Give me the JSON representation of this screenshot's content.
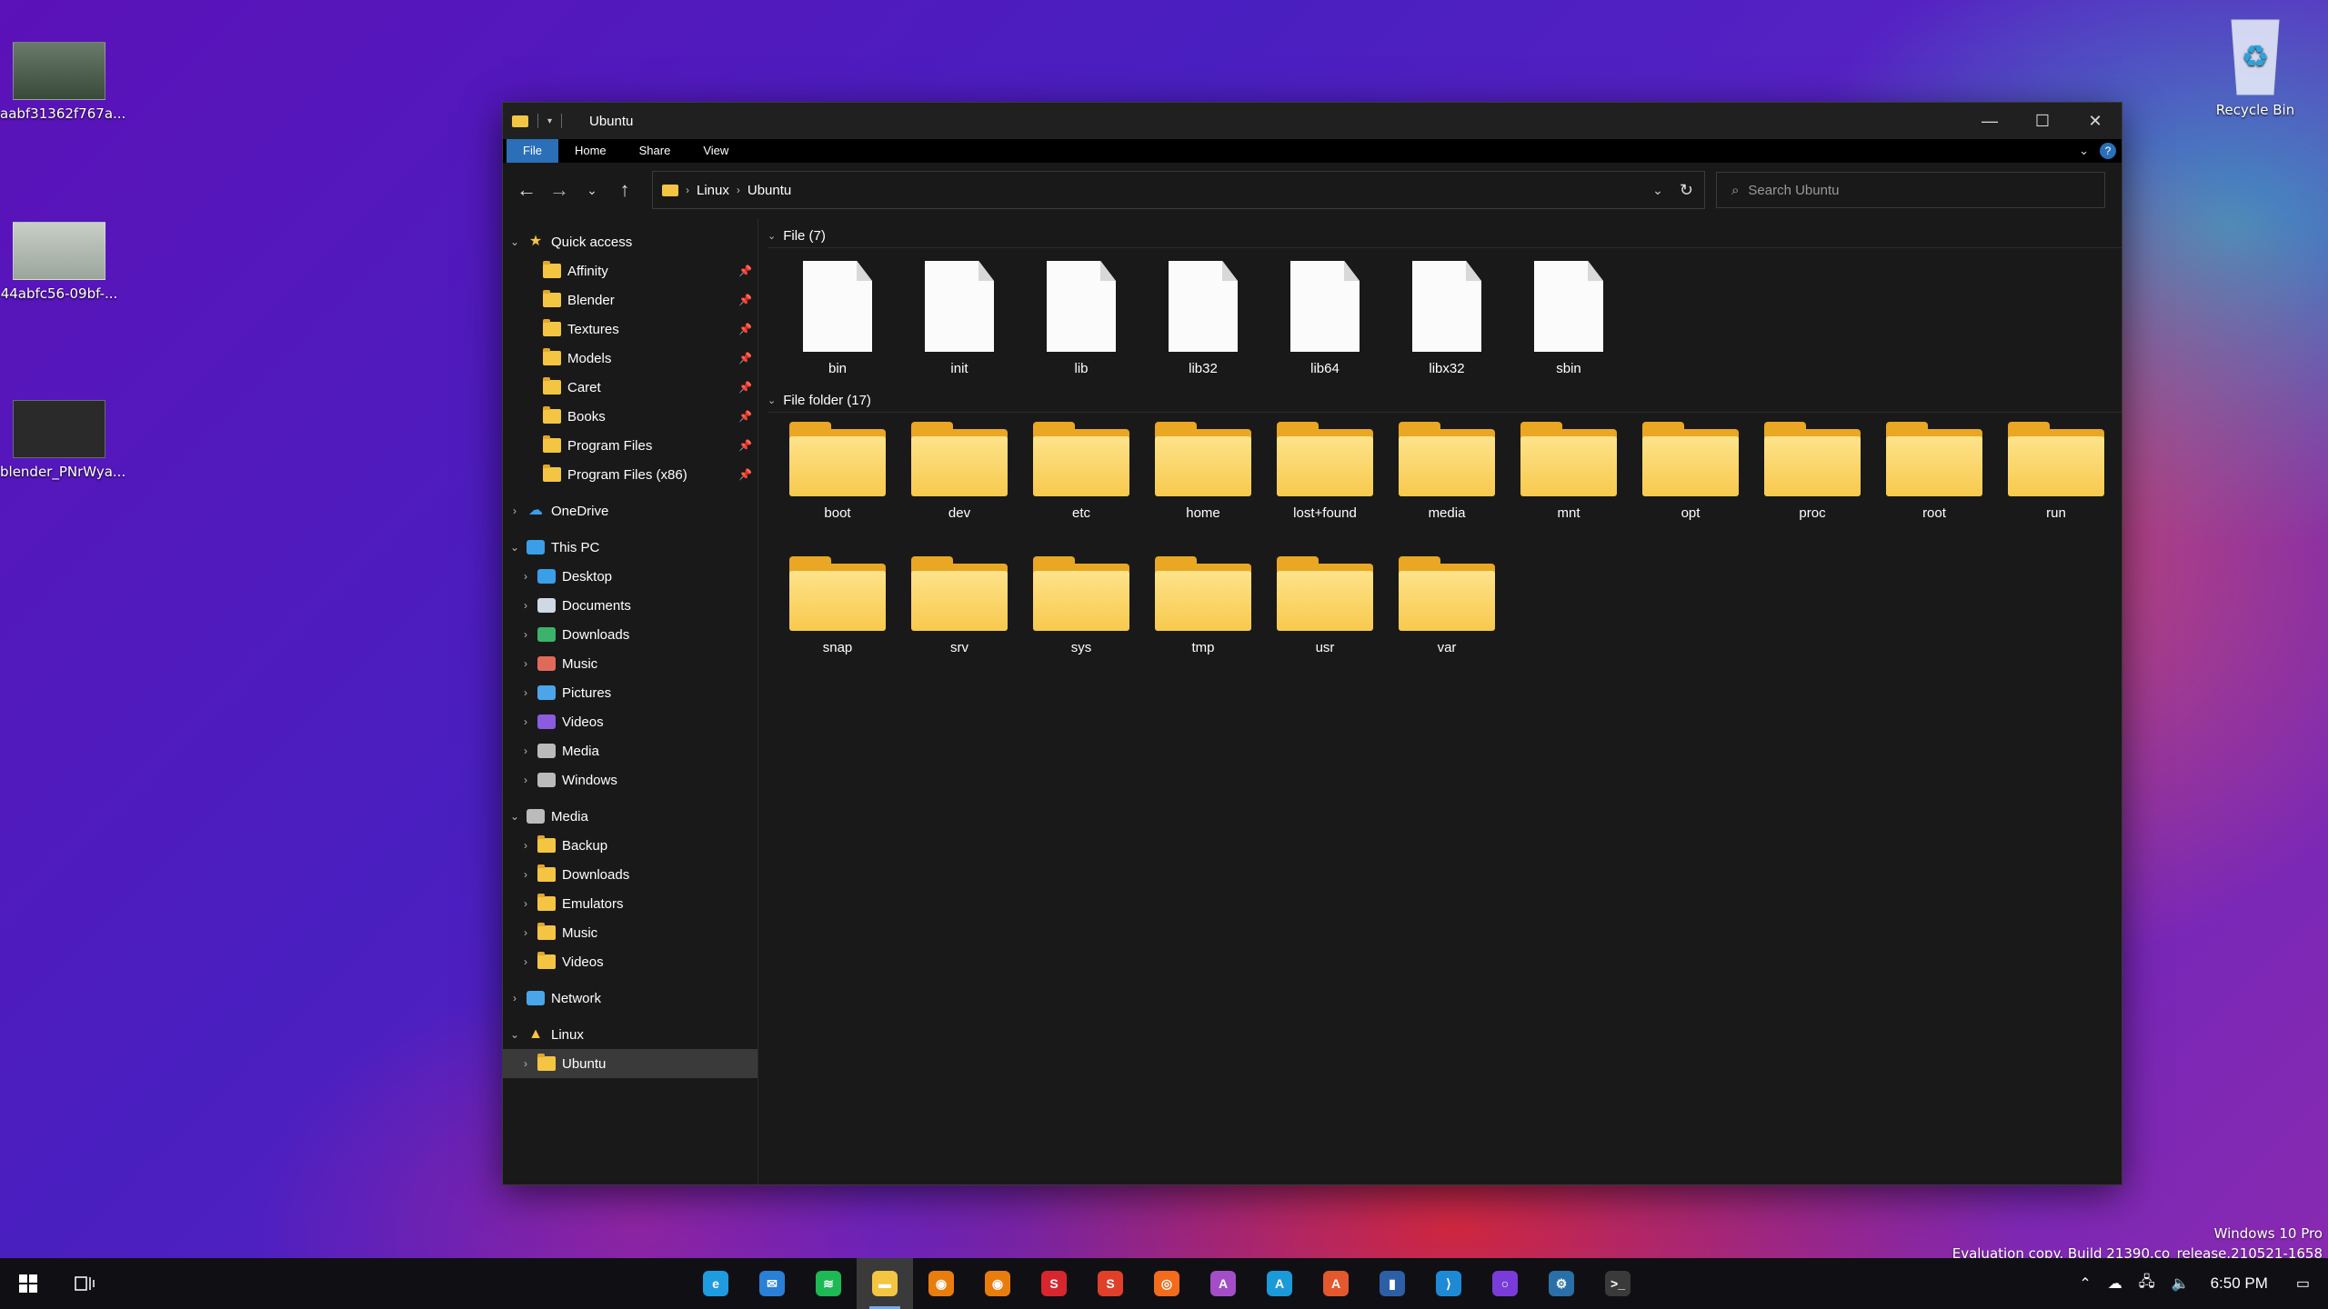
{
  "desktop": {
    "icons": [
      {
        "label": "aabf31362f767a..."
      },
      {
        "label": "44abfc56-09bf-..."
      },
      {
        "label": "blender_PNrWya..."
      }
    ],
    "recycle_bin": "Recycle Bin",
    "watermark": {
      "line1": "Windows 10 Pro",
      "line2": "Evaluation copy. Build 21390.co_release.210521-1658"
    }
  },
  "window": {
    "title": "Ubuntu",
    "ribbon_tabs": [
      "File",
      "Home",
      "Share",
      "View"
    ],
    "help_label": "?",
    "address": {
      "crumbs": [
        "Linux",
        "Ubuntu"
      ]
    },
    "search_placeholder": "Search Ubuntu",
    "sidebar": {
      "quick_access": {
        "label": "Quick access",
        "items": [
          "Affinity",
          "Blender",
          "Textures",
          "Models",
          "Caret",
          "Books",
          "Program Files",
          "Program Files (x86)"
        ]
      },
      "onedrive": "OneDrive",
      "this_pc": {
        "label": "This PC",
        "items": [
          {
            "label": "Desktop",
            "icon": "desktop-icon",
            "color": "#3a9ee8"
          },
          {
            "label": "Documents",
            "icon": "documents-icon",
            "color": "#cfd8e3"
          },
          {
            "label": "Downloads",
            "icon": "download-icon",
            "color": "#3bb36a"
          },
          {
            "label": "Music",
            "icon": "music-icon",
            "color": "#e06a5a"
          },
          {
            "label": "Pictures",
            "icon": "pictures-icon",
            "color": "#4aa6e8"
          },
          {
            "label": "Videos",
            "icon": "videos-icon",
            "color": "#8b5ce0"
          },
          {
            "label": "Media",
            "icon": "drive-icon",
            "color": "#bbbbbb"
          },
          {
            "label": "Windows",
            "icon": "drive-icon",
            "color": "#bbbbbb"
          }
        ]
      },
      "media": {
        "label": "Media",
        "items": [
          "Backup",
          "Downloads",
          "Emulators",
          "Music",
          "Videos"
        ]
      },
      "network": "Network",
      "linux": {
        "label": "Linux",
        "items": [
          "Ubuntu"
        ]
      }
    },
    "groups": [
      {
        "header": "File (7)",
        "kind": "file",
        "items": [
          "bin",
          "init",
          "lib",
          "lib32",
          "lib64",
          "libx32",
          "sbin"
        ]
      },
      {
        "header": "File folder (17)",
        "kind": "folder",
        "items": [
          "boot",
          "dev",
          "etc",
          "home",
          "lost+found",
          "media",
          "mnt",
          "opt",
          "proc",
          "root",
          "run",
          "snap",
          "srv",
          "sys",
          "tmp",
          "usr",
          "var"
        ]
      }
    ]
  },
  "taskbar": {
    "apps": [
      {
        "name": "edge-app",
        "glyph": "e",
        "color": "#1f9be0"
      },
      {
        "name": "mail-app",
        "glyph": "✉",
        "color": "#2a7fd6"
      },
      {
        "name": "spotify-app",
        "glyph": "≋",
        "color": "#1db954"
      },
      {
        "name": "file-explorer-app",
        "glyph": "▬",
        "color": "#f4c542",
        "active": true
      },
      {
        "name": "blender-app",
        "glyph": "◉",
        "color": "#e87d0d"
      },
      {
        "name": "blender-alt-app",
        "glyph": "◉",
        "color": "#e87d0d"
      },
      {
        "name": "substance-designer-app",
        "glyph": "S",
        "color": "#d8262f"
      },
      {
        "name": "substance-painter-app",
        "glyph": "S",
        "color": "#e0402a"
      },
      {
        "name": "houdini-app",
        "glyph": "◎",
        "color": "#f36b1c"
      },
      {
        "name": "affinity-photo-app",
        "glyph": "A",
        "color": "#a34ec7"
      },
      {
        "name": "affinity-designer-app",
        "glyph": "A",
        "color": "#1b9ad8"
      },
      {
        "name": "affinity-publisher-app",
        "glyph": "A",
        "color": "#e4582d"
      },
      {
        "name": "caret-app",
        "glyph": "▮",
        "color": "#2d5fa6"
      },
      {
        "name": "vscode-app",
        "glyph": "⟩",
        "color": "#1e8ad6"
      },
      {
        "name": "cortana-app",
        "glyph": "○",
        "color": "#7a3cd8"
      },
      {
        "name": "steam-app",
        "glyph": "⚙",
        "color": "#2a6fa8"
      },
      {
        "name": "terminal-app",
        "glyph": ">_",
        "color": "#3a3a3a"
      }
    ],
    "clock": "6:50 PM"
  }
}
